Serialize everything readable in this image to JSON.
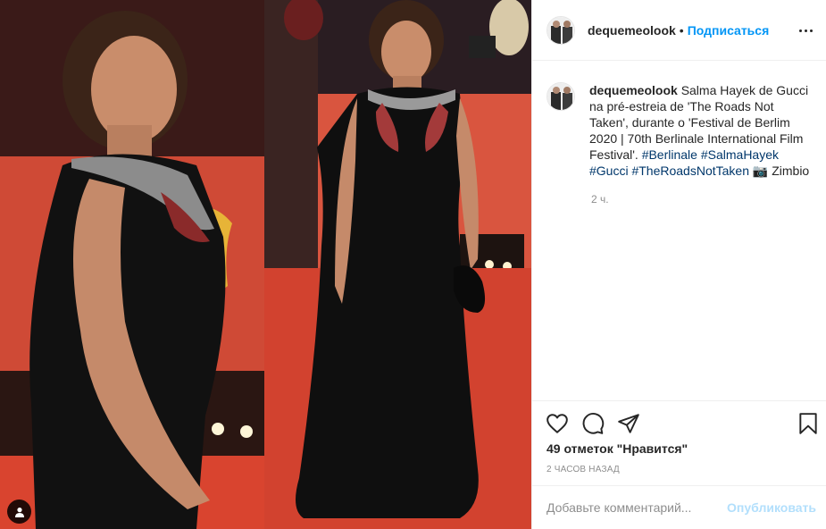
{
  "post": {
    "username": "dequemeolook",
    "separator": "•",
    "follow_label": "Подписаться",
    "more_icon": "more-horizontal-icon",
    "caption": {
      "username": "dequemeolook",
      "text": "Salma Hayek de Gucci na pré-estreia de 'The Roads Not Taken', durante o 'Festival de Berlim 2020 | 70th Berlinale International Film Festival'.",
      "hashtags": [
        "#Berlinale",
        "#SalmaHayek",
        "#Gucci",
        "#TheRoadsNotTaken"
      ],
      "credit": "📷 Zimbio",
      "time": "2 ч."
    },
    "likes_text": "49 отметок \"Нравится\"",
    "date_text": "2 часов назад",
    "comment": {
      "placeholder": "Добавьте комментарий...",
      "value": "",
      "publish_label": "Опубликовать"
    }
  },
  "icons": {
    "like": "heart-icon",
    "comment": "comment-icon",
    "share": "share-icon",
    "save": "bookmark-icon",
    "user_tag": "user-icon"
  },
  "colors": {
    "link_blue": "#0095f6",
    "hashtag_blue": "#00376b",
    "muted": "#8e8e8e",
    "red_carpet": "#c9402c"
  }
}
